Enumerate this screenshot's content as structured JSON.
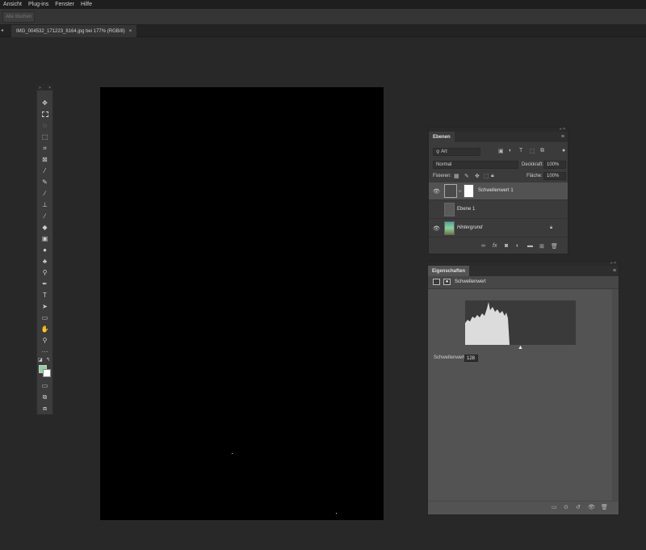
{
  "menu": [
    "Ansicht",
    "Plug-ins",
    "Fenster",
    "Hilfe"
  ],
  "options_bar": {
    "button_label": "Alle löschen"
  },
  "document_tab": {
    "title": "IMG_004532_171223_8164.jpg bei 177% (RGB/8)",
    "close": "×"
  },
  "toolbar": {
    "tools": [
      "move-tool",
      "rectangle-marquee-tool",
      "lasso-tool",
      "object-selection-tool",
      "crop-tool",
      "frame-tool",
      "eyedropper-tool",
      "spot-healing-tool",
      "brush-tool",
      "clone-stamp-tool",
      "history-brush-tool",
      "eraser-tool",
      "gradient-tool",
      "blur-tool",
      "dodge-tool",
      "pen-tool",
      "type-tool",
      "path-selection-tool",
      "rectangle-tool",
      "hand-tool",
      "zoom-tool",
      "more-tools"
    ],
    "colors": {
      "foreground": "#8fd09c",
      "background": "#ffffff"
    }
  },
  "layers_panel": {
    "tab_label": "Ebenen",
    "filter_placeholder": "Art",
    "blend_mode": "Normal",
    "opacity_label": "Deckkraft:",
    "opacity_value": "100%",
    "lock_label": "Fixieren:",
    "fill_label": "Fläche:",
    "fill_value": "100%",
    "layers": [
      {
        "name": "Schwellenwert 1",
        "type": "adjustment",
        "visible": true,
        "selected": true
      },
      {
        "name": "Ebene 1",
        "type": "pixel",
        "visible": false,
        "selected": false
      },
      {
        "name": "Hintergrund",
        "type": "background",
        "visible": true,
        "selected": false,
        "locked": true
      }
    ]
  },
  "properties_panel": {
    "tab_label": "Eigenschaften",
    "adjustment_name": "Schwellenwert",
    "threshold_label": "Schwellenwert:",
    "threshold_value": "128"
  }
}
